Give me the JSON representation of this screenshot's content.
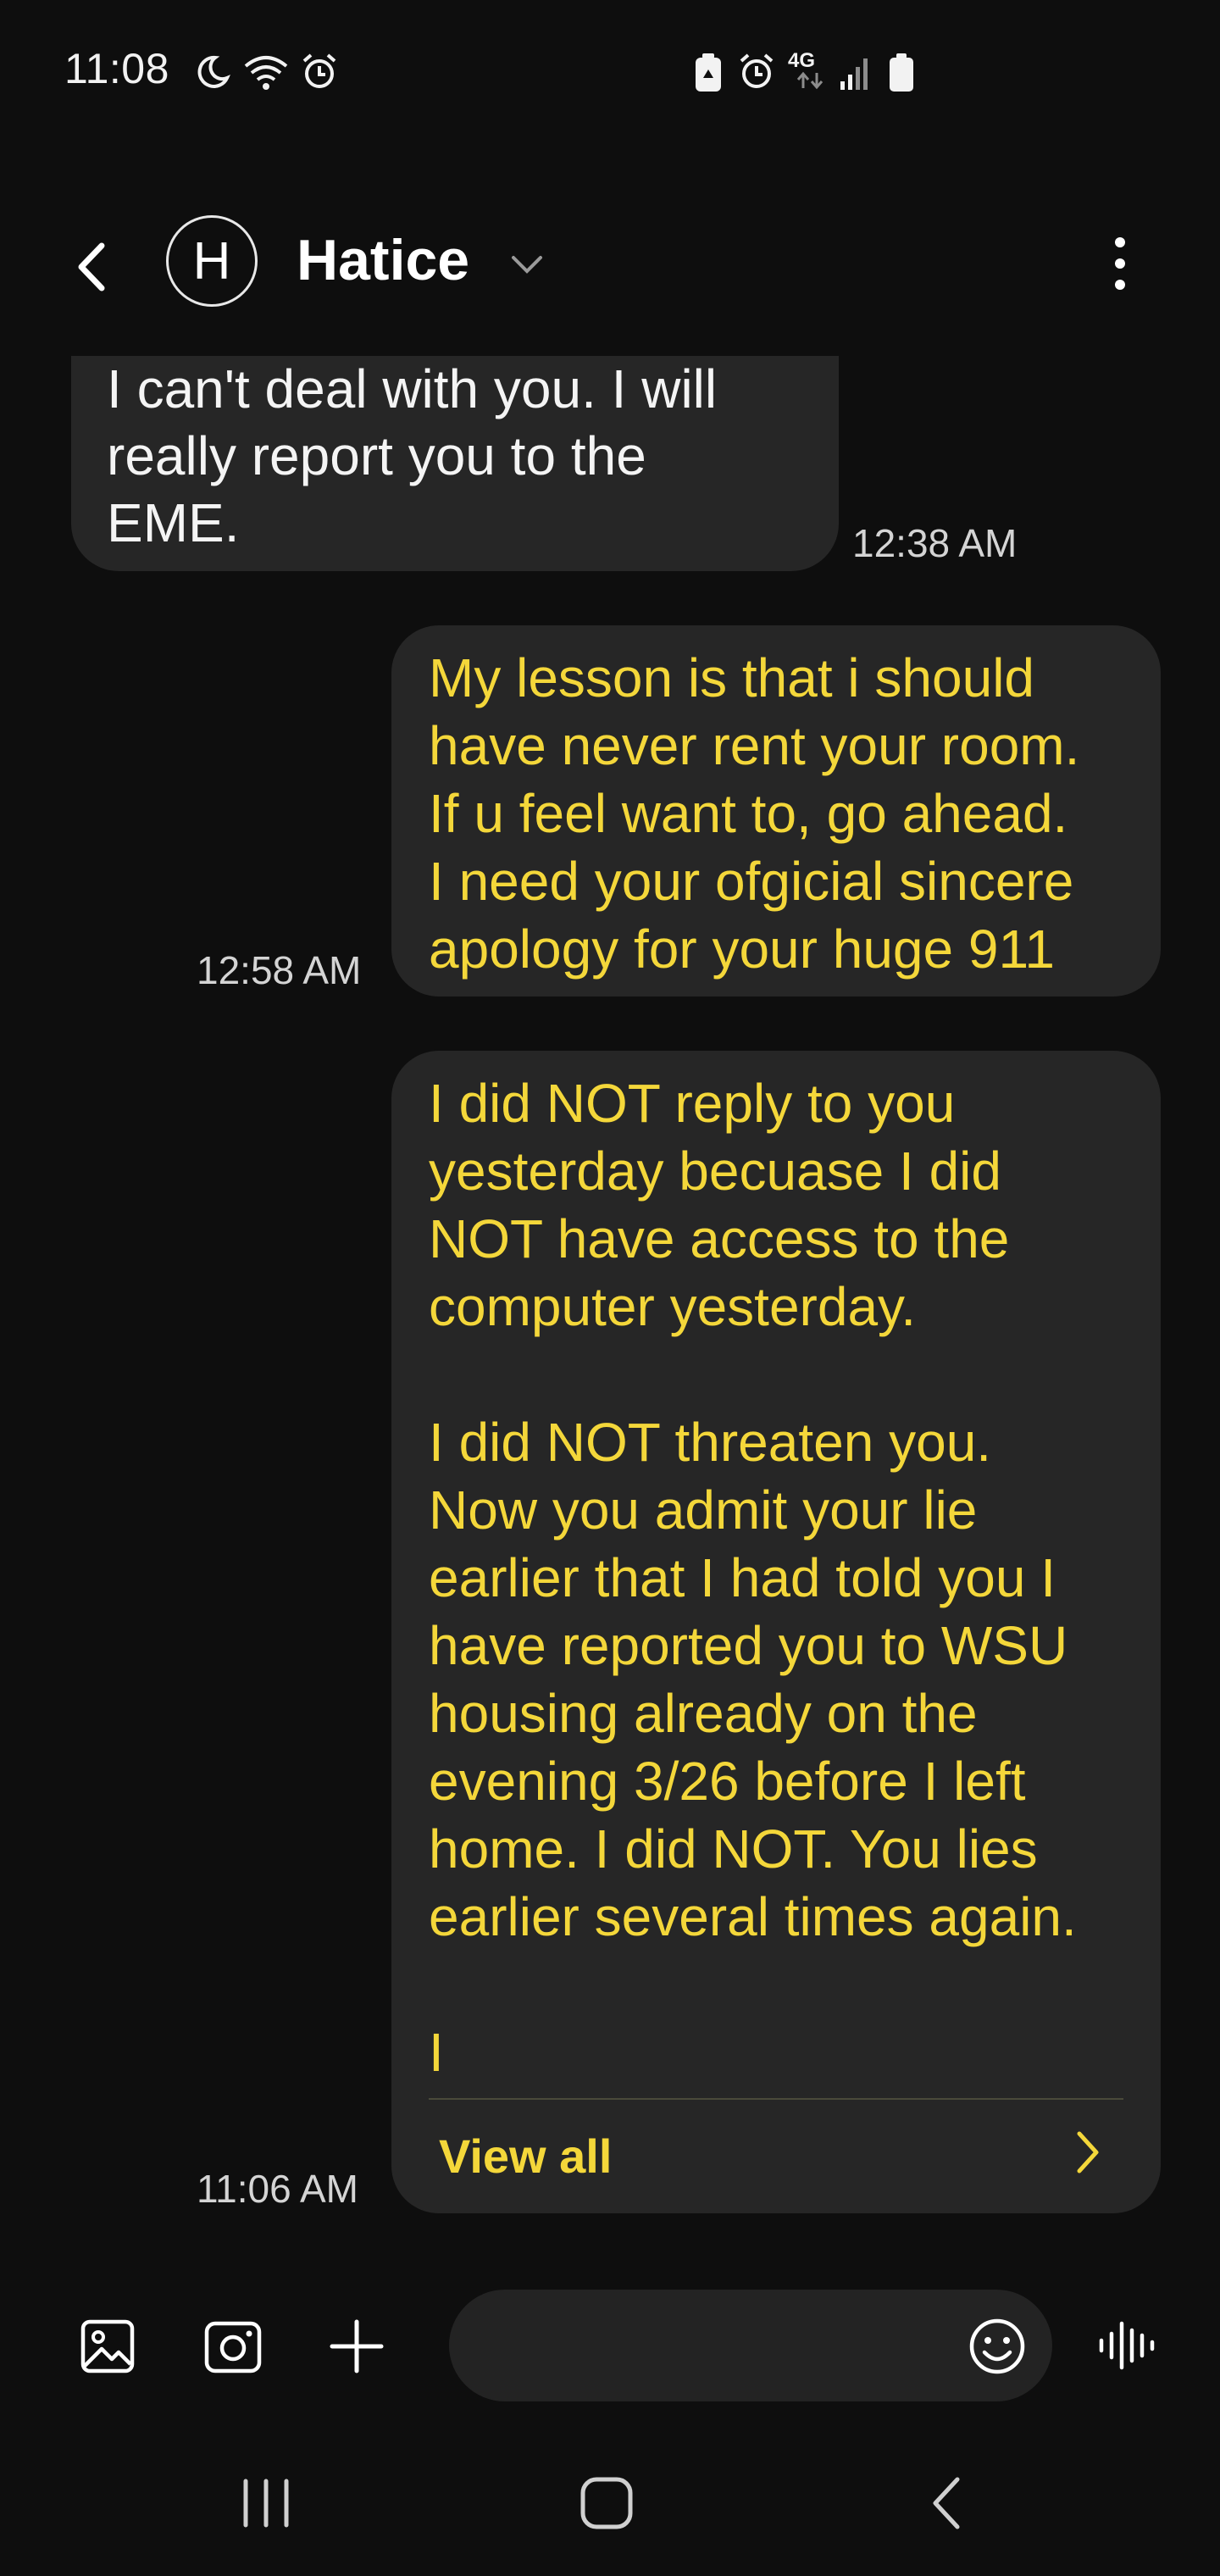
{
  "status_bar": {
    "time": "11:08",
    "left_icons": [
      "moon-icon",
      "wifi-icon",
      "alarm-icon"
    ],
    "right_icons": [
      "battery-saver-icon",
      "alarm-icon",
      "network-4g-icon",
      "signal-icon",
      "battery-icon"
    ],
    "network_label": "4G"
  },
  "header": {
    "avatar_letter": "H",
    "contact_name": "Hatice"
  },
  "colors": {
    "background": "#0e0e0e",
    "bubble": "#262626",
    "outgoing_text": "#f4d73a",
    "incoming_text": "#f4f4f4"
  },
  "messages": [
    {
      "direction": "incoming",
      "text": "I can't deal with you. I will\nreally report you to the\nEME.",
      "time": "12:38 AM"
    },
    {
      "direction": "outgoing",
      "text": "My lesson is that i should\nhave never rent your room.\nIf u feel want to, go ahead.\nI need your ofgicial sincere\napology for your huge 911",
      "time": "12:58 AM"
    },
    {
      "direction": "outgoing",
      "text": "I did NOT reply to you\nyesterday becuase I did\nNOT have access to the\ncomputer yesterday.\n\nI did NOT threaten you.\nNow you admit your lie\nearlier that I had told you I\nhave reported you to WSU\nhousing already on the\nevening 3/26 before I left\nhome. I did NOT. You lies\nearlier several times again.\n\nI",
      "time": "11:06 AM",
      "view_all_label": "View all"
    }
  ],
  "composer": {
    "icons": [
      "gallery-icon",
      "camera-icon",
      "plus-icon",
      "emoji-icon",
      "voice-icon"
    ],
    "input_value": ""
  },
  "nav_bar": {
    "icons": [
      "recents-icon",
      "home-icon",
      "back-icon"
    ]
  }
}
